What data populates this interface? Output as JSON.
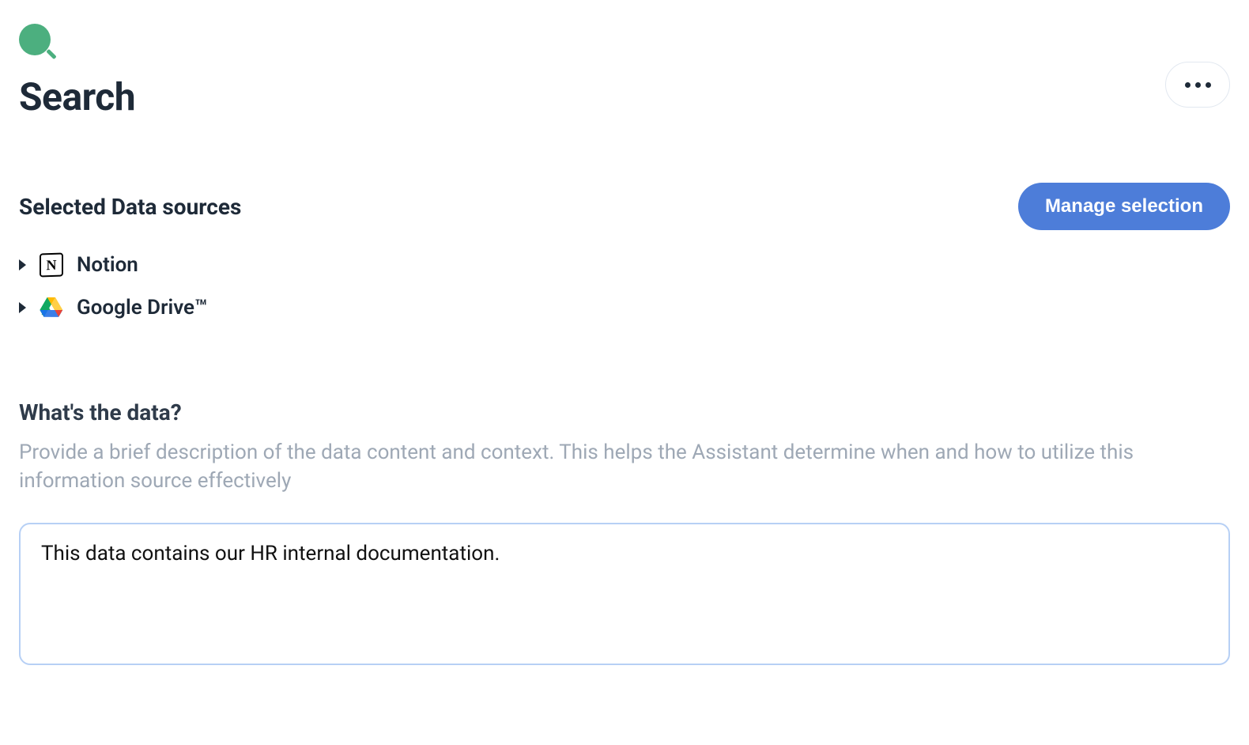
{
  "header": {
    "title": "Search"
  },
  "dataSources": {
    "heading": "Selected Data sources",
    "manageLabel": "Manage selection",
    "items": [
      {
        "label": "Notion",
        "iconName": "notion-icon"
      },
      {
        "label": "Google Drive™",
        "iconName": "google-drive-icon"
      }
    ]
  },
  "whatsTheData": {
    "heading": "What's the data?",
    "description": "Provide a brief description of the data content and context. This helps the Assistant determine when and how to utilize this information source effectively",
    "value": "This data contains our HR internal documentation."
  }
}
